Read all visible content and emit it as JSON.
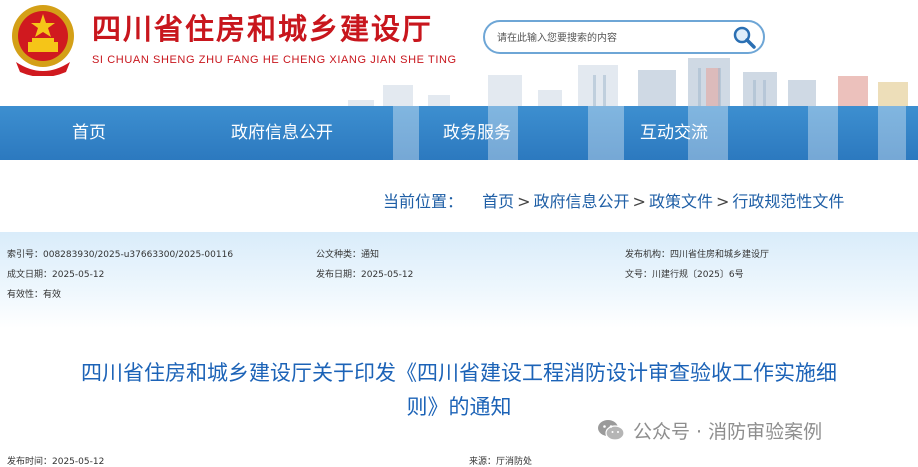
{
  "header": {
    "title": "四川省住房和城乡建设厅",
    "pinyin": "SI CHUAN SHENG ZHU FANG HE CHENG XIANG JIAN SHE TING",
    "search_placeholder": "请在此输入您要搜索的内容"
  },
  "nav": {
    "items": [
      "首页",
      "政府信息公开",
      "政务服务",
      "互动交流"
    ]
  },
  "breadcrumb": {
    "label": "当前位置：",
    "items": [
      "首页",
      "政府信息公开",
      "政策文件",
      "行政规范性文件"
    ],
    "separator": ">"
  },
  "meta": {
    "index_no": "索引号：008283930/2025-u37663300/2025-00116",
    "doc_type": "公文种类：通知",
    "issuer": "发布机构：四川省住房和城乡建设厅",
    "created": "成文日期：2025-05-12",
    "published": "发布日期：2025-05-12",
    "doc_no": "文号：川建行规〔2025〕6号",
    "validity": "有效性：有效"
  },
  "article": {
    "title_line1": "四川省住房和城乡建设厅关于印发《四川省建设工程消防设计审查验收工作实施细",
    "title_line2": "则》的通知"
  },
  "watermark": {
    "text": "公众号 · 消防审验案例"
  },
  "footer_meta": {
    "publish_time": "发布时间：2025-05-12",
    "source": "来源：厅消防处"
  },
  "colors": {
    "brand_red": "#c8161d",
    "nav_blue": "#2c79bf",
    "link_blue": "#1f5fa6",
    "title_blue": "#1c63b7"
  }
}
